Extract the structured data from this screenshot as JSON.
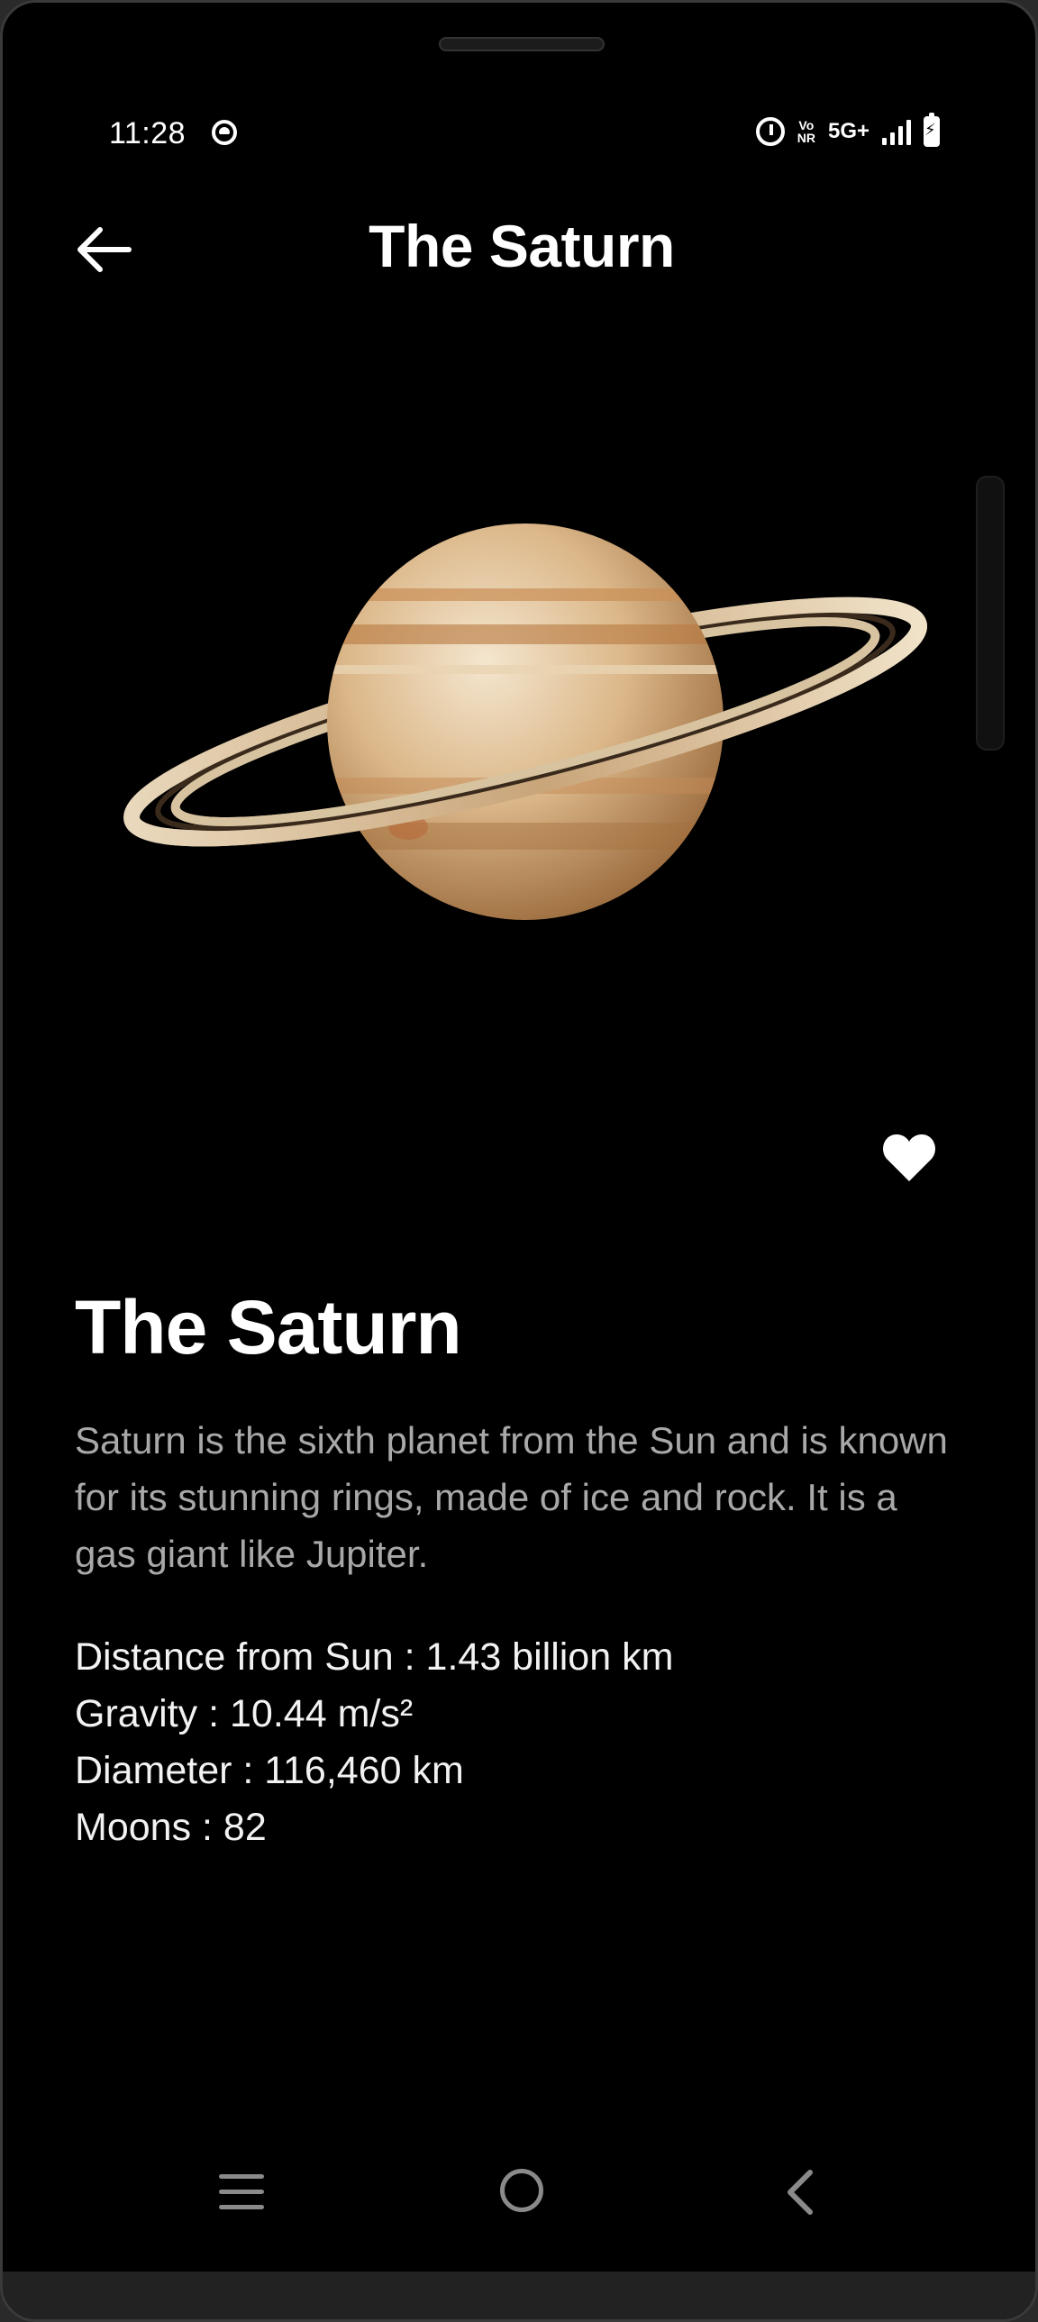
{
  "status_bar": {
    "time": "11:28",
    "volte_top": "Vo",
    "volte_bottom": "NR",
    "network": "5G+"
  },
  "app_bar": {
    "title": "The Saturn",
    "back_icon": "arrow-left-icon"
  },
  "planet": {
    "image_alt": "Saturn planet image",
    "favorite_icon": "heart-icon",
    "is_favorite": true
  },
  "detail": {
    "name": "The Saturn",
    "description": "Saturn is the sixth planet from the Sun and is known for its stunning rings, made of ice and rock. It is a gas giant like Jupiter.",
    "facts": [
      "Distance from Sun : 1.43 billion km",
      "Gravity : 10.44 m/s²",
      "Diameter : 116,460 km",
      "Moons : 82"
    ]
  },
  "nav_bar": {
    "menu_icon": "menu-icon",
    "home_icon": "home-circle-icon",
    "back_icon": "chevron-left-icon"
  },
  "colors": {
    "background": "#000000",
    "text_primary": "#ffffff",
    "text_secondary": "#a8a8a8",
    "nav_icons": "#8a8a8a"
  }
}
